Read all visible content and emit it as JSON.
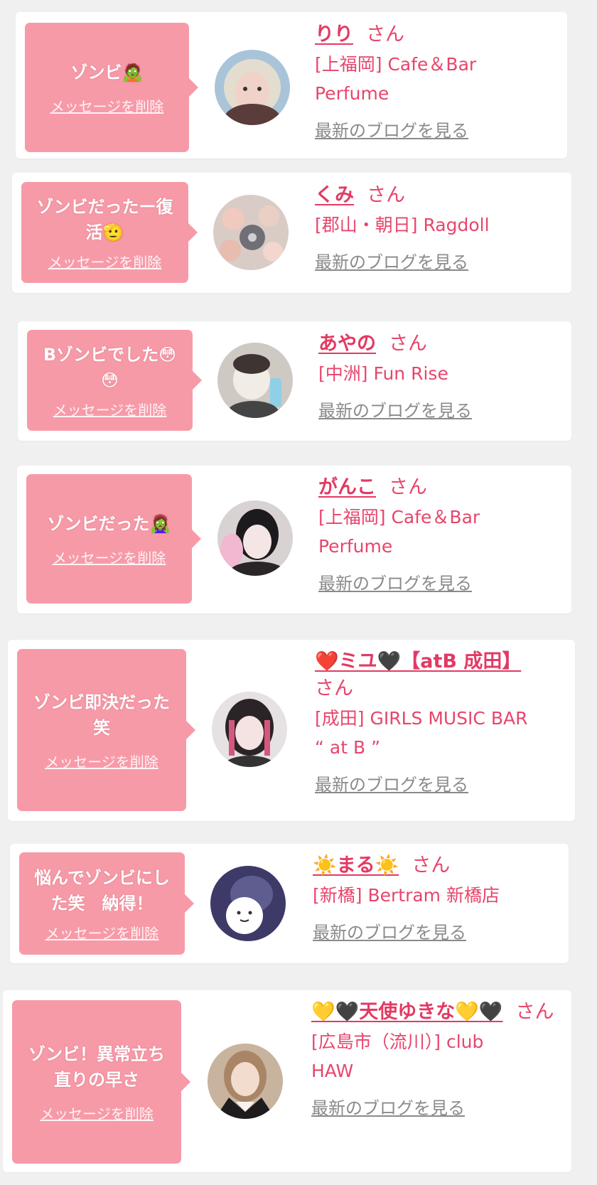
{
  "colors": {
    "background": "#f1f0f1",
    "bubble": "#f79aa8",
    "name": "#e23a63",
    "shop": "#e8456b",
    "blog_link": "#8a8a8a"
  },
  "entries": [
    {
      "message_lines": [
        "ゾンビ🧟"
      ],
      "delete_label": "メッセージを削除",
      "name": "りり",
      "honorific": "さん",
      "shop_lines": [
        "[上福岡] Cafe＆Bar",
        "Perfume"
      ],
      "blog_label": "最新のブログを見る",
      "avatar": "profile-photo"
    },
    {
      "message_lines": [
        "ゾンビだったー復",
        "活🫡"
      ],
      "delete_label": "メッセージを削除",
      "name": "くみ",
      "honorific": "さん",
      "shop_lines": [
        "[郡山・朝日] Ragdoll"
      ],
      "blog_label": "最新のブログを見る",
      "avatar": "profile-photo"
    },
    {
      "message_lines": [
        "Bゾンビでした😳",
        "😳"
      ],
      "delete_label": "メッセージを削除",
      "name": "あやの",
      "honorific": "さん",
      "shop_lines": [
        "[中洲] Fun Rise"
      ],
      "blog_label": "最新のブログを見る",
      "avatar": "profile-photo"
    },
    {
      "message_lines": [
        "ゾンビだった🧟‍♀️"
      ],
      "delete_label": "メッセージを削除",
      "name": "がんこ",
      "honorific": "さん",
      "shop_lines": [
        "[上福岡] Cafe＆Bar",
        "Perfume"
      ],
      "blog_label": "最新のブログを見る",
      "avatar": "profile-photo"
    },
    {
      "message_lines": [
        "ゾンビ即決だった",
        "笑"
      ],
      "delete_label": "メッセージを削除",
      "name": "❤️ミユ🖤【atB 成田】",
      "honorific": "さん",
      "shop_lines": [
        "[成田] GIRLS MUSIC BAR",
        "“ at B ”"
      ],
      "blog_label": "最新のブログを見る",
      "avatar": "profile-photo"
    },
    {
      "message_lines": [
        "悩んでゾンビにし",
        "た笑　納得！"
      ],
      "delete_label": "メッセージを削除",
      "name": "☀️まる☀️",
      "honorific": "さん",
      "shop_lines": [
        "[新橋] Bertram 新橋店"
      ],
      "blog_label": "最新のブログを見る",
      "avatar": "profile-photo"
    },
    {
      "message_lines": [
        "ゾンビ！異常立ち",
        "直りの早さ"
      ],
      "delete_label": "メッセージを削除",
      "name": "💛🖤天使ゆきな💛🖤",
      "honorific": "さん",
      "shop_lines": [
        "[広島市（流川）] club",
        "HAW"
      ],
      "blog_label": "最新のブログを見る",
      "avatar": "profile-photo"
    }
  ]
}
